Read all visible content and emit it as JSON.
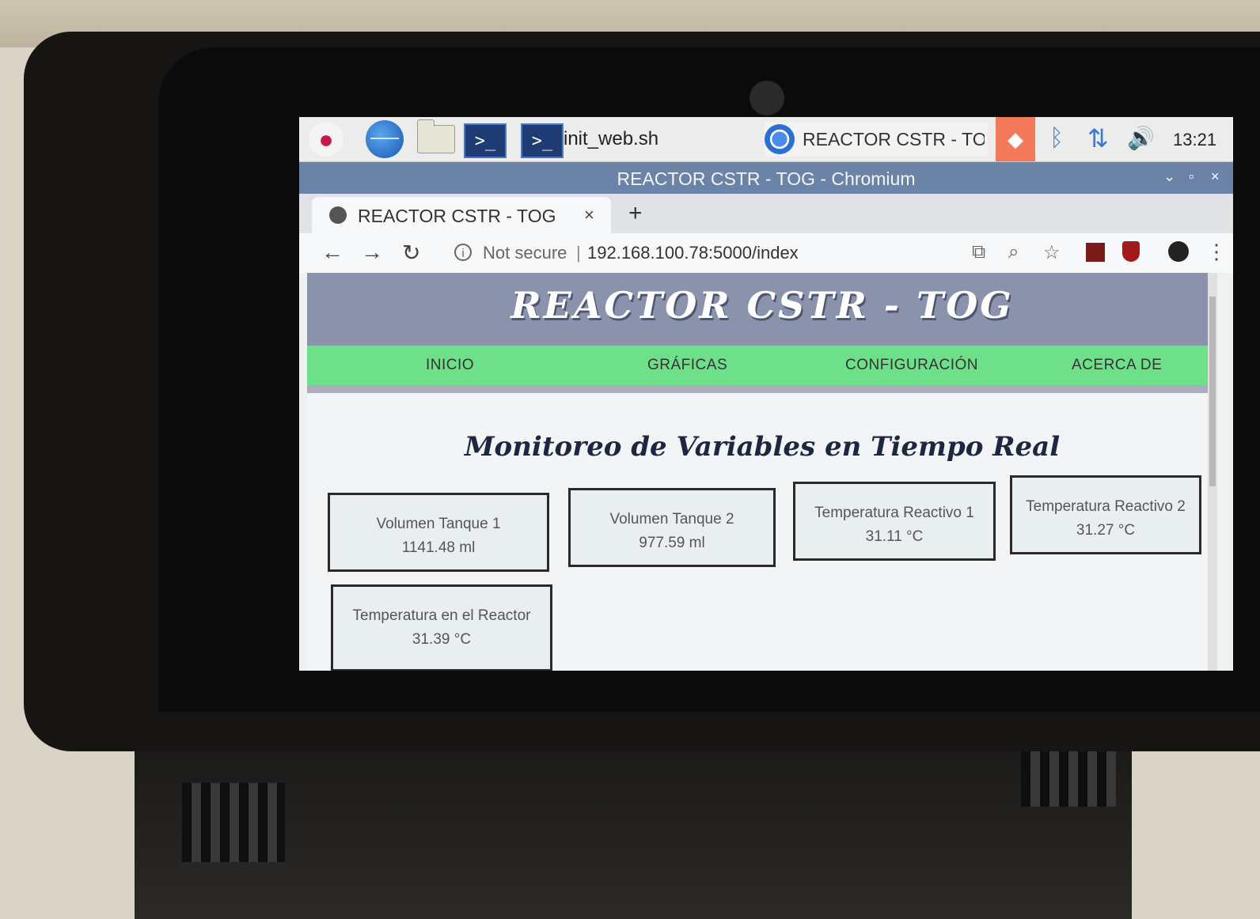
{
  "taskbar": {
    "rasp_icon": "raspberry-pi-menu-icon",
    "term_glyph": ">_",
    "task_label": "init_web.sh",
    "chrome_task": "REACTOR CSTR - TO...",
    "clock": "13:21",
    "bluetooth_glyph": "ᛒ",
    "network_glyph": "⇅",
    "volume_glyph": "🔊"
  },
  "window": {
    "title": "REACTOR CSTR - TOG - Chromium",
    "minimize": "⌄",
    "maximize": "▫",
    "close": "×"
  },
  "tab": {
    "title": "REACTOR CSTR - TOG",
    "close": "×",
    "new_tab": "+"
  },
  "toolbar": {
    "back": "←",
    "forward": "→",
    "reload": "↻",
    "info": "i",
    "not_secure": "Not secure",
    "separator": "|",
    "url": "192.168.100.78:5000/index",
    "zoom": "⌕",
    "bookmark": "☆",
    "menu": "⋮"
  },
  "site": {
    "title": "REACTOR CSTR - TOG",
    "nav": [
      "INICIO",
      "GRÁFICAS",
      "CONFIGURACIÓN",
      "ACERCA DE"
    ],
    "section_title": "Monitoreo de Variables en Tiempo Real",
    "cards": [
      {
        "label": "Volumen Tanque 1",
        "value": "1141.48 ml"
      },
      {
        "label": "Volumen Tanque 2",
        "value": "977.59 ml"
      },
      {
        "label": "Temperatura Reactivo 1",
        "value": "31.11 °C"
      },
      {
        "label": "Temperatura Reactivo 2",
        "value": "31.27 °C"
      },
      {
        "label": "Temperatura en el Reactor",
        "value": "31.39 °C"
      }
    ]
  },
  "colors": {
    "header": "#8a93ab",
    "nav": "#6fe08a",
    "titlebar": "#6c83a8"
  }
}
